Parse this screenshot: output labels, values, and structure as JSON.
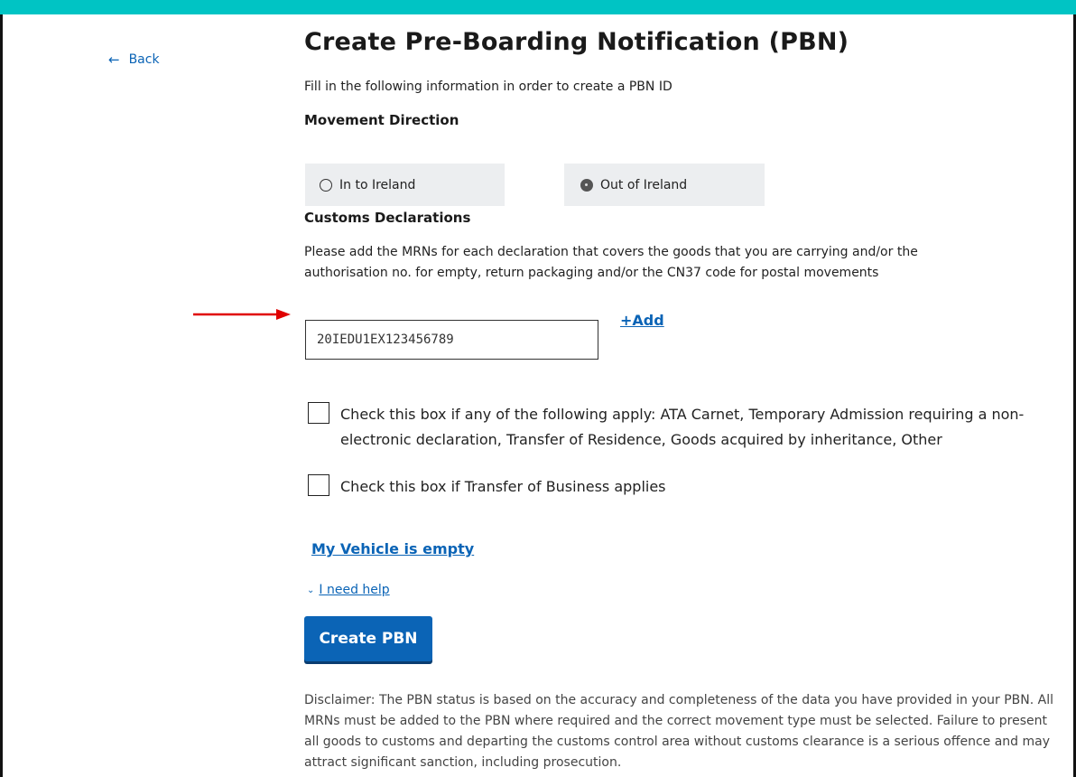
{
  "nav": {
    "back_label": "Back"
  },
  "page": {
    "title": "Create Pre-Boarding Notification (PBN)",
    "intro": "Fill in the following information in order to create a PBN ID"
  },
  "movement": {
    "heading": "Movement Direction",
    "options": [
      {
        "label": "In to Ireland",
        "selected": false
      },
      {
        "label": "Out of Ireland",
        "selected": true
      }
    ]
  },
  "customs": {
    "heading": "Customs Declarations",
    "help": "Please add the MRNs for each declaration that covers the goods that you are carrying and/or the authorisation no. for empty, return packaging and/or the CN37 code for postal movements",
    "mrn_value": "20IEDU1EX123456789",
    "add_label": "+Add"
  },
  "checkboxes": [
    {
      "label": "Check this box if any of the following apply: ATA Carnet, Temporary Admission requiring a non-electronic declaration, Transfer of Residence, Goods acquired by inheritance, Other",
      "checked": false
    },
    {
      "label": "Check this box if Transfer of Business applies",
      "checked": false
    }
  ],
  "links": {
    "vehicle_empty": "My Vehicle is empty",
    "help_toggle": "I need help"
  },
  "actions": {
    "create_label": "Create PBN"
  },
  "disclaimer": "Disclaimer: The PBN status is based on the accuracy and completeness of the data you have provided in your PBN. All MRNs must be added to the PBN where required and the correct movement type must be selected. Failure to present all goods to customs and departing the customs control area without customs clearance is a serious offence and may attract significant sanction, including prosecution.",
  "colors": {
    "topbar": "#00c4c4",
    "link": "#0b64b6",
    "button": "#0b64b6",
    "annotation_arrow": "#e00000"
  }
}
